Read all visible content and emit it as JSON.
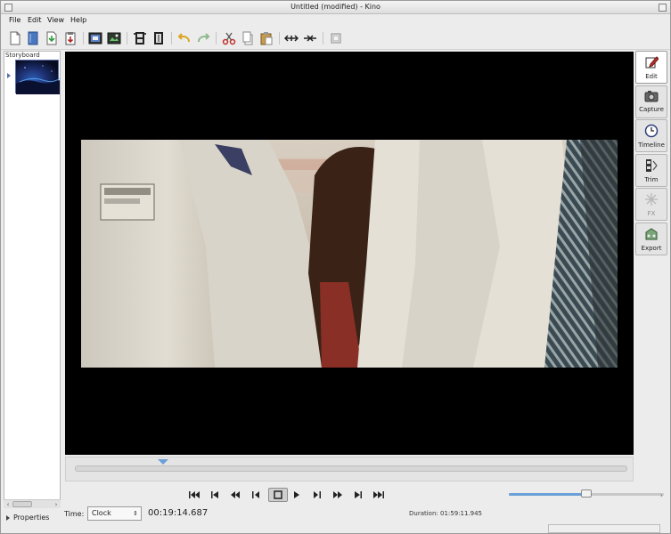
{
  "window": {
    "title": "Untitled (modified) - Kino"
  },
  "menu": [
    "File",
    "Edit",
    "View",
    "Help"
  ],
  "toolbar": {
    "icons": [
      "new-icon",
      "open-icon",
      "save-icon",
      "save-as-icon",
      "capture-frame-icon",
      "export-frame-icon",
      "split-scene-icon",
      "join-scene-icon",
      "undo-icon",
      "redo-icon",
      "cut-icon",
      "copy-icon",
      "paste-icon",
      "arrow-collapse-icon",
      "arrow-expand-icon",
      "preferences-icon"
    ]
  },
  "storyboard": {
    "label": "Storyboard"
  },
  "properties": {
    "label": "Properties"
  },
  "side_panel": {
    "items": [
      {
        "label": "Edit",
        "icon": "edit-icon",
        "active": true
      },
      {
        "label": "Capture",
        "icon": "camera-icon",
        "active": false
      },
      {
        "label": "Timeline",
        "icon": "clock-icon",
        "active": false
      },
      {
        "label": "Trim",
        "icon": "trim-icon",
        "active": false
      },
      {
        "label": "FX",
        "icon": "fx-icon",
        "active": false,
        "disabled": true
      },
      {
        "label": "Export",
        "icon": "export-icon",
        "active": false
      }
    ]
  },
  "scrubber": {
    "position": 0.16
  },
  "transport": {
    "buttons": [
      {
        "label": "⏮",
        "name": "start-icon"
      },
      {
        "label": "⏮",
        "name": "prev-scene-icon"
      },
      {
        "label": "⏪",
        "name": "rewind-icon"
      },
      {
        "label": "◀◀",
        "name": "step-back-icon"
      },
      {
        "label": "■",
        "name": "stop-icon",
        "active": true
      },
      {
        "label": "▶",
        "name": "play-icon"
      },
      {
        "label": "▶▶",
        "name": "step-forward-icon"
      },
      {
        "label": "⏩",
        "name": "fast-forward-icon"
      },
      {
        "label": "⏭",
        "name": "next-scene-icon"
      },
      {
        "label": "⏭",
        "name": "end-icon"
      }
    ]
  },
  "volume": {
    "level": 0.5
  },
  "time": {
    "label": "Time:",
    "format": "Clock",
    "value": "00:19:14.687",
    "duration": "Duration: 01:59:11.945"
  },
  "colors": {
    "accent": "#6aa0d8",
    "video_bg": "#000000"
  }
}
